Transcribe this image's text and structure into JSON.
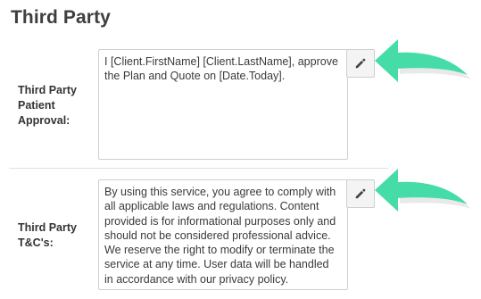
{
  "section": {
    "title": "Third Party"
  },
  "fields": [
    {
      "label_lines": [
        "Third Party",
        "Patient",
        "Approval:"
      ],
      "text": "I [Client.FirstName] [Client.LastName], approve the Plan and Quote on [Date.Today].",
      "action_icon": "pencil-icon"
    },
    {
      "label_lines": [
        "Third Party",
        "T&C's:"
      ],
      "text": "By using this service, you agree to comply with all applicable laws and regulations. Content provided is for informational purposes only and should not be considered professional advice. We reserve the right to modify or terminate the service at any time. User data will be handled in accordance with our privacy policy.",
      "action_icon": "pencil-icon"
    }
  ],
  "colors": {
    "callout_arrow": "#45dca8",
    "icon": "#444444",
    "border": "#cfcfcf"
  }
}
